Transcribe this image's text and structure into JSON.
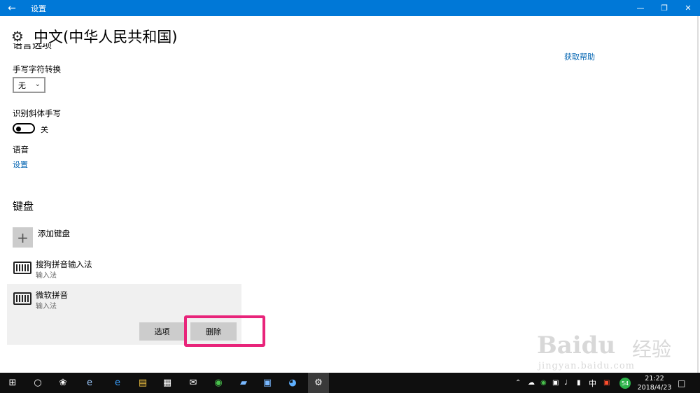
{
  "window": {
    "title": "设置"
  },
  "page": {
    "title": "中文(中华人民共和国)",
    "cut_heading": "语言选项",
    "help_link": "获取帮助"
  },
  "handwriting": {
    "label": "手写字符转换",
    "combo_value": "无",
    "italic_label": "识别斜体手写",
    "italic_state": "关"
  },
  "speech": {
    "label": "语音",
    "link": "设置"
  },
  "keyboard": {
    "title": "键盘",
    "add_label": "添加键盘",
    "items": [
      {
        "name": "搜狗拼音输入法",
        "sub": "输入法"
      },
      {
        "name": "微软拼音",
        "sub": "输入法"
      }
    ],
    "options_label": "选项",
    "delete_label": "删除"
  },
  "watermark": {
    "brand": "Baidu",
    "jingyan": "经验",
    "url": "jingyan.baidu.com"
  },
  "taskbar": {
    "ime": "中",
    "time": "21:22",
    "date": "2018/4/23",
    "badge": "54"
  },
  "colors": {
    "accent": "#0078d7",
    "link": "#0063b1",
    "highlight": "#e8247a",
    "taskbar": "#0f0f0f"
  }
}
